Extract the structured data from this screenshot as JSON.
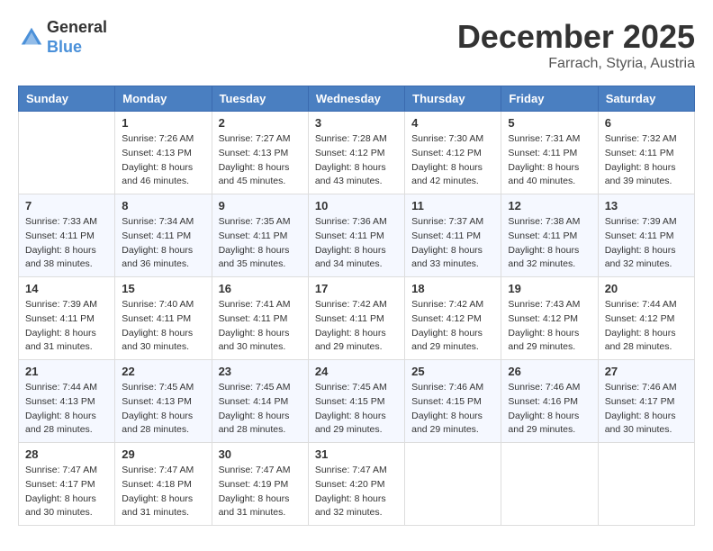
{
  "header": {
    "logo_general": "General",
    "logo_blue": "Blue",
    "month_year": "December 2025",
    "location": "Farrach, Styria, Austria"
  },
  "weekdays": [
    "Sunday",
    "Monday",
    "Tuesday",
    "Wednesday",
    "Thursday",
    "Friday",
    "Saturday"
  ],
  "weeks": [
    [
      {
        "day": "",
        "sunrise": "",
        "sunset": "",
        "daylight": ""
      },
      {
        "day": "1",
        "sunrise": "Sunrise: 7:26 AM",
        "sunset": "Sunset: 4:13 PM",
        "daylight": "Daylight: 8 hours and 46 minutes."
      },
      {
        "day": "2",
        "sunrise": "Sunrise: 7:27 AM",
        "sunset": "Sunset: 4:13 PM",
        "daylight": "Daylight: 8 hours and 45 minutes."
      },
      {
        "day": "3",
        "sunrise": "Sunrise: 7:28 AM",
        "sunset": "Sunset: 4:12 PM",
        "daylight": "Daylight: 8 hours and 43 minutes."
      },
      {
        "day": "4",
        "sunrise": "Sunrise: 7:30 AM",
        "sunset": "Sunset: 4:12 PM",
        "daylight": "Daylight: 8 hours and 42 minutes."
      },
      {
        "day": "5",
        "sunrise": "Sunrise: 7:31 AM",
        "sunset": "Sunset: 4:11 PM",
        "daylight": "Daylight: 8 hours and 40 minutes."
      },
      {
        "day": "6",
        "sunrise": "Sunrise: 7:32 AM",
        "sunset": "Sunset: 4:11 PM",
        "daylight": "Daylight: 8 hours and 39 minutes."
      }
    ],
    [
      {
        "day": "7",
        "sunrise": "Sunrise: 7:33 AM",
        "sunset": "Sunset: 4:11 PM",
        "daylight": "Daylight: 8 hours and 38 minutes."
      },
      {
        "day": "8",
        "sunrise": "Sunrise: 7:34 AM",
        "sunset": "Sunset: 4:11 PM",
        "daylight": "Daylight: 8 hours and 36 minutes."
      },
      {
        "day": "9",
        "sunrise": "Sunrise: 7:35 AM",
        "sunset": "Sunset: 4:11 PM",
        "daylight": "Daylight: 8 hours and 35 minutes."
      },
      {
        "day": "10",
        "sunrise": "Sunrise: 7:36 AM",
        "sunset": "Sunset: 4:11 PM",
        "daylight": "Daylight: 8 hours and 34 minutes."
      },
      {
        "day": "11",
        "sunrise": "Sunrise: 7:37 AM",
        "sunset": "Sunset: 4:11 PM",
        "daylight": "Daylight: 8 hours and 33 minutes."
      },
      {
        "day": "12",
        "sunrise": "Sunrise: 7:38 AM",
        "sunset": "Sunset: 4:11 PM",
        "daylight": "Daylight: 8 hours and 32 minutes."
      },
      {
        "day": "13",
        "sunrise": "Sunrise: 7:39 AM",
        "sunset": "Sunset: 4:11 PM",
        "daylight": "Daylight: 8 hours and 32 minutes."
      }
    ],
    [
      {
        "day": "14",
        "sunrise": "Sunrise: 7:39 AM",
        "sunset": "Sunset: 4:11 PM",
        "daylight": "Daylight: 8 hours and 31 minutes."
      },
      {
        "day": "15",
        "sunrise": "Sunrise: 7:40 AM",
        "sunset": "Sunset: 4:11 PM",
        "daylight": "Daylight: 8 hours and 30 minutes."
      },
      {
        "day": "16",
        "sunrise": "Sunrise: 7:41 AM",
        "sunset": "Sunset: 4:11 PM",
        "daylight": "Daylight: 8 hours and 30 minutes."
      },
      {
        "day": "17",
        "sunrise": "Sunrise: 7:42 AM",
        "sunset": "Sunset: 4:11 PM",
        "daylight": "Daylight: 8 hours and 29 minutes."
      },
      {
        "day": "18",
        "sunrise": "Sunrise: 7:42 AM",
        "sunset": "Sunset: 4:12 PM",
        "daylight": "Daylight: 8 hours and 29 minutes."
      },
      {
        "day": "19",
        "sunrise": "Sunrise: 7:43 AM",
        "sunset": "Sunset: 4:12 PM",
        "daylight": "Daylight: 8 hours and 29 minutes."
      },
      {
        "day": "20",
        "sunrise": "Sunrise: 7:44 AM",
        "sunset": "Sunset: 4:12 PM",
        "daylight": "Daylight: 8 hours and 28 minutes."
      }
    ],
    [
      {
        "day": "21",
        "sunrise": "Sunrise: 7:44 AM",
        "sunset": "Sunset: 4:13 PM",
        "daylight": "Daylight: 8 hours and 28 minutes."
      },
      {
        "day": "22",
        "sunrise": "Sunrise: 7:45 AM",
        "sunset": "Sunset: 4:13 PM",
        "daylight": "Daylight: 8 hours and 28 minutes."
      },
      {
        "day": "23",
        "sunrise": "Sunrise: 7:45 AM",
        "sunset": "Sunset: 4:14 PM",
        "daylight": "Daylight: 8 hours and 28 minutes."
      },
      {
        "day": "24",
        "sunrise": "Sunrise: 7:45 AM",
        "sunset": "Sunset: 4:15 PM",
        "daylight": "Daylight: 8 hours and 29 minutes."
      },
      {
        "day": "25",
        "sunrise": "Sunrise: 7:46 AM",
        "sunset": "Sunset: 4:15 PM",
        "daylight": "Daylight: 8 hours and 29 minutes."
      },
      {
        "day": "26",
        "sunrise": "Sunrise: 7:46 AM",
        "sunset": "Sunset: 4:16 PM",
        "daylight": "Daylight: 8 hours and 29 minutes."
      },
      {
        "day": "27",
        "sunrise": "Sunrise: 7:46 AM",
        "sunset": "Sunset: 4:17 PM",
        "daylight": "Daylight: 8 hours and 30 minutes."
      }
    ],
    [
      {
        "day": "28",
        "sunrise": "Sunrise: 7:47 AM",
        "sunset": "Sunset: 4:17 PM",
        "daylight": "Daylight: 8 hours and 30 minutes."
      },
      {
        "day": "29",
        "sunrise": "Sunrise: 7:47 AM",
        "sunset": "Sunset: 4:18 PM",
        "daylight": "Daylight: 8 hours and 31 minutes."
      },
      {
        "day": "30",
        "sunrise": "Sunrise: 7:47 AM",
        "sunset": "Sunset: 4:19 PM",
        "daylight": "Daylight: 8 hours and 31 minutes."
      },
      {
        "day": "31",
        "sunrise": "Sunrise: 7:47 AM",
        "sunset": "Sunset: 4:20 PM",
        "daylight": "Daylight: 8 hours and 32 minutes."
      },
      {
        "day": "",
        "sunrise": "",
        "sunset": "",
        "daylight": ""
      },
      {
        "day": "",
        "sunrise": "",
        "sunset": "",
        "daylight": ""
      },
      {
        "day": "",
        "sunrise": "",
        "sunset": "",
        "daylight": ""
      }
    ]
  ]
}
